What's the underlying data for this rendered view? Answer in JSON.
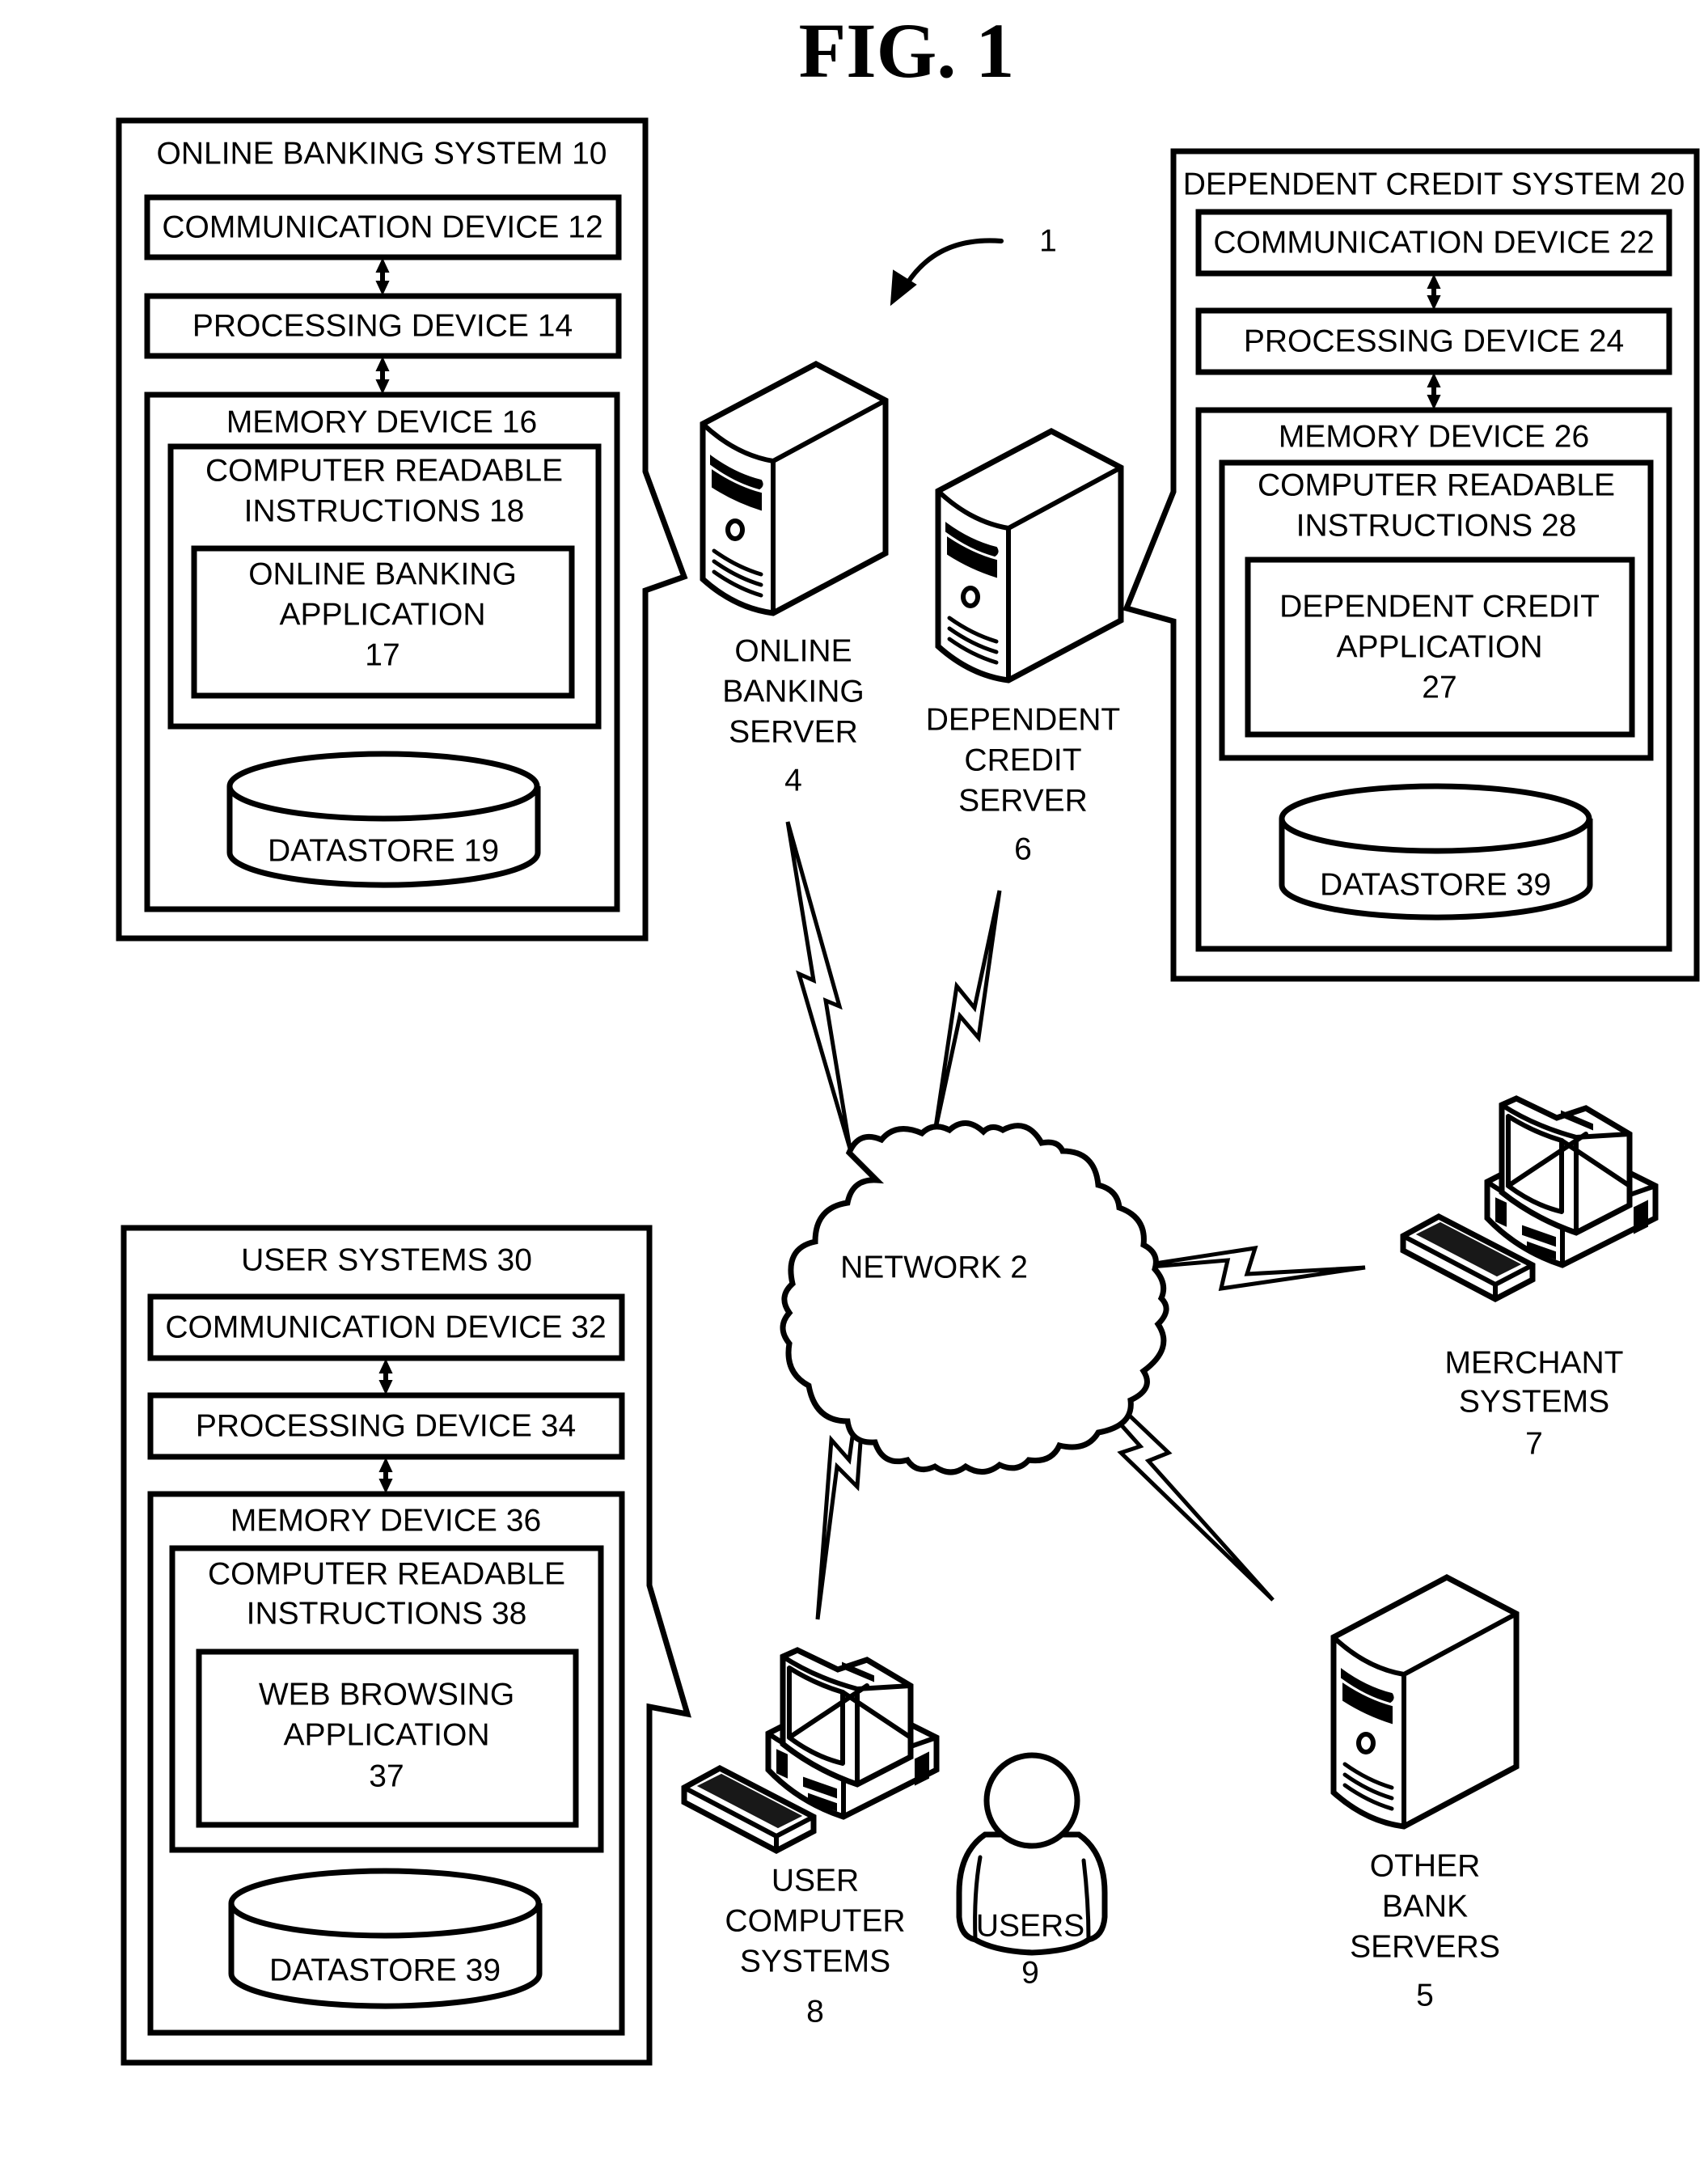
{
  "figure": {
    "title": "FIG. 1",
    "system_ref": "1",
    "colors": {
      "ink": "#000000",
      "paper": "#ffffff"
    }
  },
  "online_banking_system": {
    "title": "ONLINE BANKING SYSTEM 10",
    "communication_device": "COMMUNICATION DEVICE 12",
    "processing_device": "PROCESSING DEVICE 14",
    "memory_device": "MEMORY DEVICE 16",
    "instructions": [
      "COMPUTER READABLE",
      "INSTRUCTIONS 18"
    ],
    "application": [
      "ONLINE BANKING",
      "APPLICATION",
      "17"
    ],
    "datastore": "DATASTORE 19"
  },
  "dependent_credit_system": {
    "title": "DEPENDENT CREDIT SYSTEM 20",
    "communication_device": "COMMUNICATION DEVICE 22",
    "processing_device": "PROCESSING DEVICE 24",
    "memory_device": "MEMORY DEVICE 26",
    "instructions": [
      "COMPUTER READABLE",
      "INSTRUCTIONS 28"
    ],
    "application": [
      "DEPENDENT CREDIT",
      "APPLICATION",
      "27"
    ],
    "datastore": "DATASTORE 39"
  },
  "user_systems": {
    "title": "USER SYSTEMS 30",
    "communication_device": "COMMUNICATION DEVICE 32",
    "processing_device": "PROCESSING DEVICE 34",
    "memory_device": "MEMORY DEVICE 36",
    "instructions": [
      "COMPUTER READABLE",
      "INSTRUCTIONS 38"
    ],
    "application": [
      "WEB BROWSING",
      "APPLICATION",
      "37"
    ],
    "datastore": "DATASTORE 39"
  },
  "nodes": {
    "online_banking_server": [
      "ONLINE",
      "BANKING",
      "SERVER",
      "4"
    ],
    "dependent_credit_server": [
      "DEPENDENT",
      "CREDIT",
      "SERVER",
      "6"
    ],
    "network": "NETWORK 2",
    "merchant_systems": [
      "MERCHANT",
      "SYSTEMS",
      "7"
    ],
    "user_computer_systems": [
      "USER",
      "COMPUTER",
      "SYSTEMS",
      "8"
    ],
    "users": [
      "USERS",
      "9"
    ],
    "other_bank_servers": [
      "OTHER",
      "BANK",
      "SERVERS",
      "5"
    ]
  }
}
